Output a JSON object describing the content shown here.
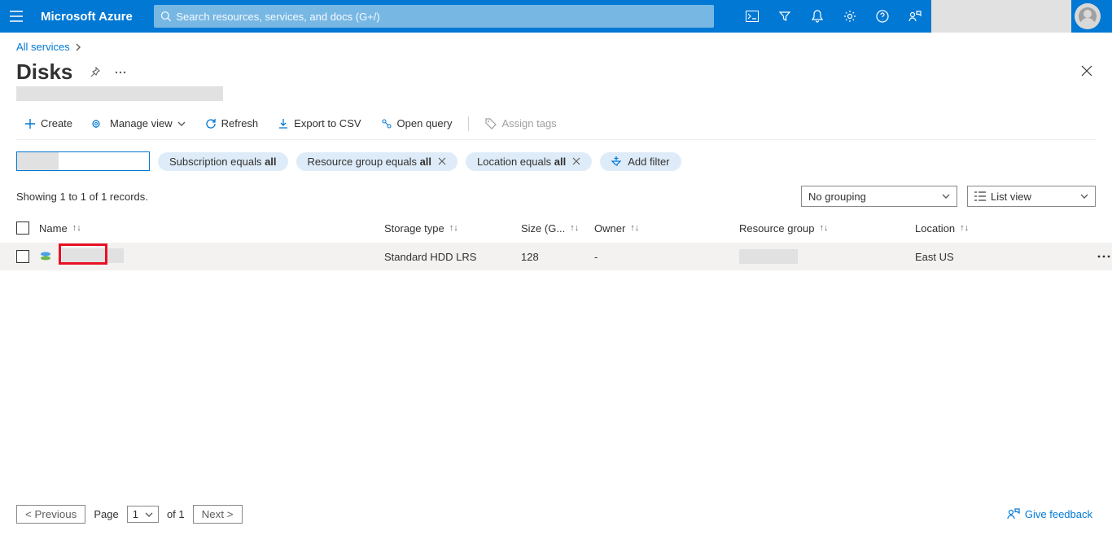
{
  "header": {
    "brand": "Microsoft Azure",
    "search_placeholder": "Search resources, services, and docs (G+/)"
  },
  "breadcrumb": {
    "root": "All services"
  },
  "page": {
    "title": "Disks"
  },
  "toolbar": {
    "create": "Create",
    "manage_view": "Manage view",
    "refresh": "Refresh",
    "export_csv": "Export to CSV",
    "open_query": "Open query",
    "assign_tags": "Assign tags"
  },
  "filters": {
    "subscription_prefix": "Subscription equals ",
    "subscription_value": "all",
    "rg_prefix": "Resource group equals ",
    "rg_value": "all",
    "location_prefix": "Location equals ",
    "location_value": "all",
    "add_filter": "Add filter"
  },
  "records": {
    "summary": "Showing 1 to 1 of 1 records.",
    "grouping": "No grouping",
    "list_view": "List view"
  },
  "columns": {
    "name": "Name",
    "storage": "Storage type",
    "size": "Size (G...",
    "owner": "Owner",
    "rg": "Resource group",
    "location": "Location"
  },
  "rows": [
    {
      "storage": "Standard HDD LRS",
      "size": "128",
      "owner": "-",
      "location": "East US"
    }
  ],
  "pager": {
    "previous": "< Previous",
    "page_label": "Page",
    "page_value": "1",
    "of_label": "of 1",
    "next": "Next >"
  },
  "feedback": "Give feedback"
}
